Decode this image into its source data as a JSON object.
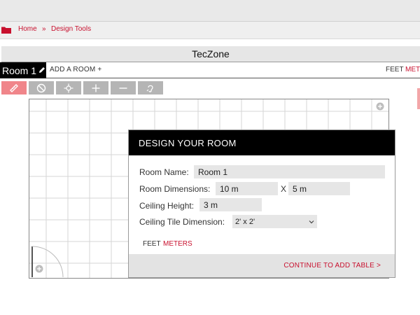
{
  "breadcrumb": {
    "home": "Home",
    "separator": "»",
    "current": "Design Tools"
  },
  "app_title": "TecZone",
  "tabs": {
    "room_tab": "Room 1",
    "add_room": "ADD A ROOM +"
  },
  "units": {
    "feet": "FEET",
    "meters": "METERS"
  },
  "toolbar": {
    "tools": [
      "ruler-icon",
      "no-entry-icon",
      "crosshair-icon",
      "plus-icon",
      "minus-icon",
      "ear-icon"
    ],
    "active": "ruler-icon"
  },
  "modal": {
    "title": "DESIGN YOUR ROOM",
    "room_name_label": "Room Name:",
    "room_name_value": "Room 1",
    "dimensions_label": "Room Dimensions:",
    "width_value": "10 m",
    "x_label": "X",
    "length_value": "5 m",
    "ceiling_height_label": "Ceiling Height:",
    "ceiling_height_value": "3 m",
    "ceiling_tile_label": "Ceiling Tile Dimension:",
    "ceiling_tile_value": "2' x 2'",
    "unit_feet": "FEET",
    "unit_meters": "METERS",
    "continue_label": "CONTINUE TO ADD TABLE >"
  },
  "colors": {
    "accent": "#c8102e",
    "active_tool": "#f0858a",
    "tool_bg": "#b5b5b5",
    "modal_header": "#000000"
  }
}
